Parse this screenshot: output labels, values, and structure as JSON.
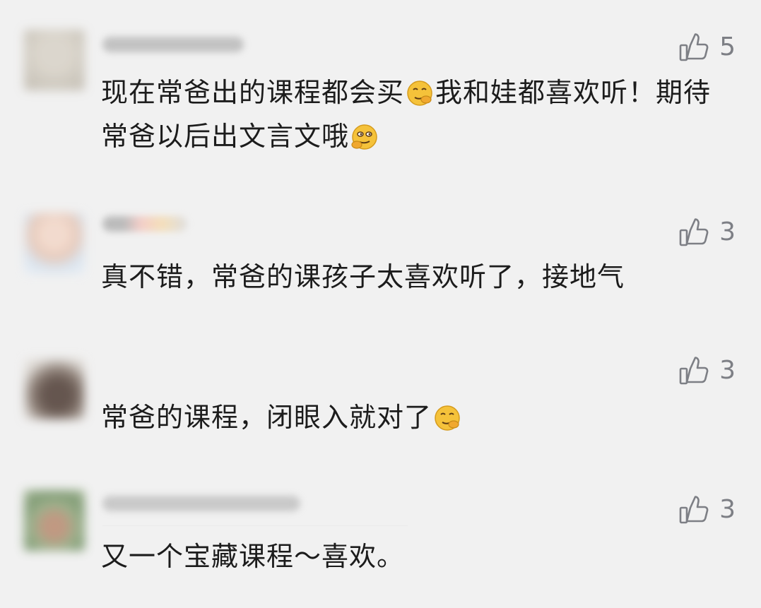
{
  "comments": [
    {
      "like_count": "5",
      "text_part1": "现在常爸出的课程都会买",
      "emoji1": "smirk-emoji",
      "text_part2": "我和娃都喜欢听！期待常爸以后出文言文哦",
      "emoji2": "sly-smirk-emoji"
    },
    {
      "like_count": "3",
      "text": "真不错，常爸的课孩子太喜欢听了，接地气"
    },
    {
      "like_count": "3",
      "text": "常爸的课程，闭眼入就对了",
      "emoji": "smirk-emoji"
    },
    {
      "like_count": "3",
      "text": "又一个宝藏课程～喜欢。"
    }
  ],
  "colors": {
    "background": "#f1f1f1",
    "text": "#1c1c1c",
    "like": "#7d7f85",
    "emoji_fill": "#f5c23a"
  },
  "icons": {
    "like": "thumbs-up-icon"
  }
}
